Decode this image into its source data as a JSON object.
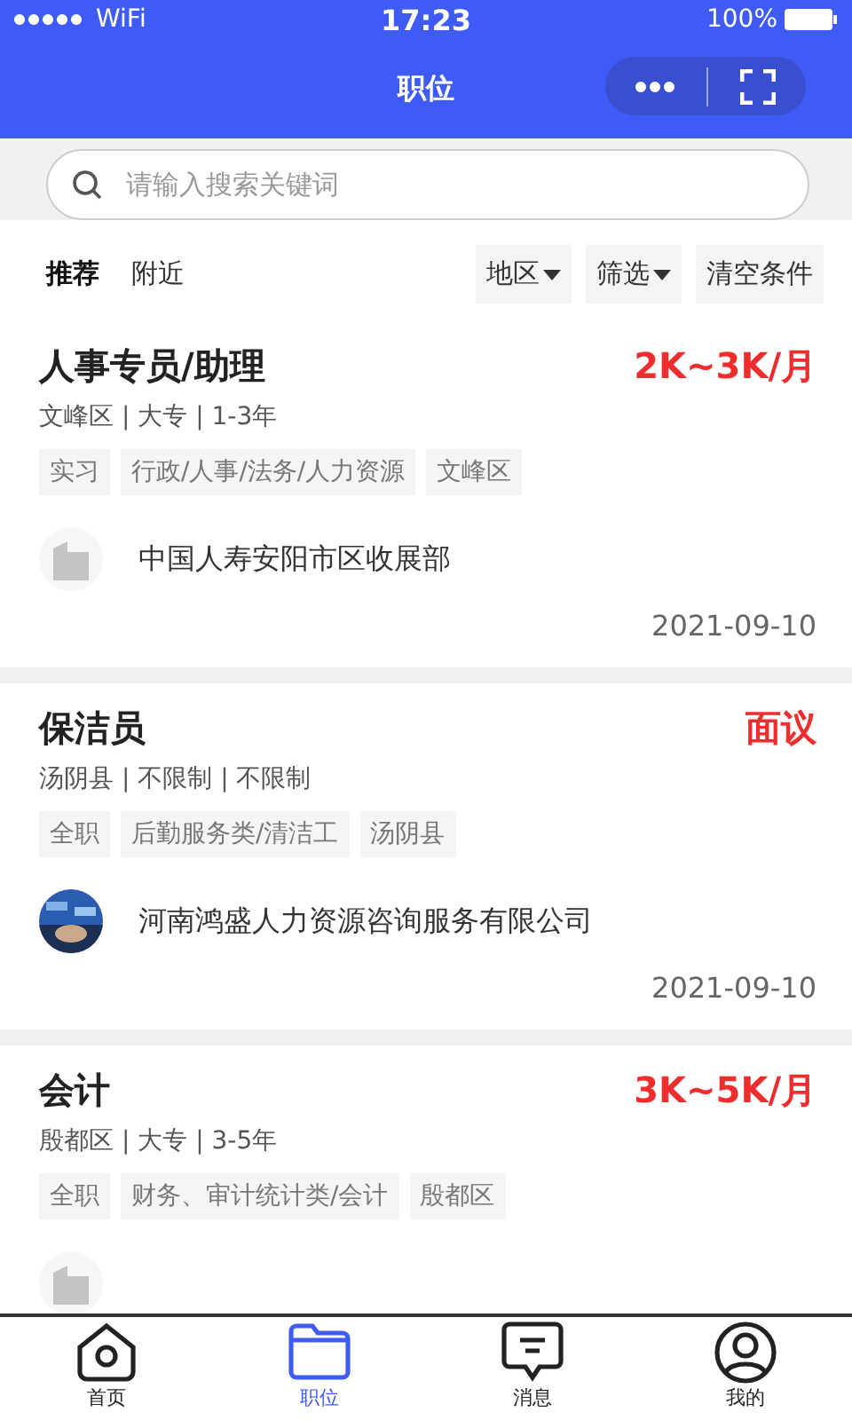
{
  "status_bar": {
    "carrier": "WiFi",
    "time": "17:23",
    "battery": "100%"
  },
  "nav": {
    "title": "职位"
  },
  "search": {
    "placeholder": "请输入搜索关键词"
  },
  "tabs": [
    {
      "label": "推荐",
      "selected": true
    },
    {
      "label": "附近",
      "selected": false
    }
  ],
  "filters": [
    {
      "label": "地区",
      "kind": "dropdown"
    },
    {
      "label": "筛选",
      "kind": "dropdown"
    },
    {
      "label": "清空条件",
      "kind": "button"
    }
  ],
  "jobs": [
    {
      "title": "人事专员/助理",
      "salary": "2K~3K/月",
      "meta": "文峰区 | 大专 | 1-3年",
      "tags": [
        "实习",
        "行政/人事/法务/人力资源",
        "文峰区"
      ],
      "logo": {
        "kind": "building"
      },
      "company": "中国人寿安阳市区收展部",
      "date": "2021-09-10"
    },
    {
      "title": "保洁员",
      "salary": "面议",
      "meta": "汤阴县 | 不限制 | 不限制",
      "tags": [
        "全职",
        "后勤服务类/清洁工",
        "汤阴县"
      ],
      "logo": {
        "kind": "picture"
      },
      "company": "河南鸿盛人力资源咨询服务有限公司",
      "date": "2021-09-10"
    },
    {
      "title": "会计",
      "salary": "3K~5K/月",
      "meta": "殷都区 | 大专 | 3-5年",
      "tags": [
        "全职",
        "财务、审计统计类/会计",
        "殷都区"
      ],
      "logo": {
        "kind": "building"
      }
    }
  ],
  "tab_bar": [
    {
      "label": "首页",
      "kind": "home",
      "selected": false
    },
    {
      "label": "职位",
      "kind": "folder",
      "selected": true
    },
    {
      "label": "消息",
      "kind": "message",
      "selected": false
    },
    {
      "label": "我的",
      "kind": "user",
      "selected": false
    }
  ]
}
